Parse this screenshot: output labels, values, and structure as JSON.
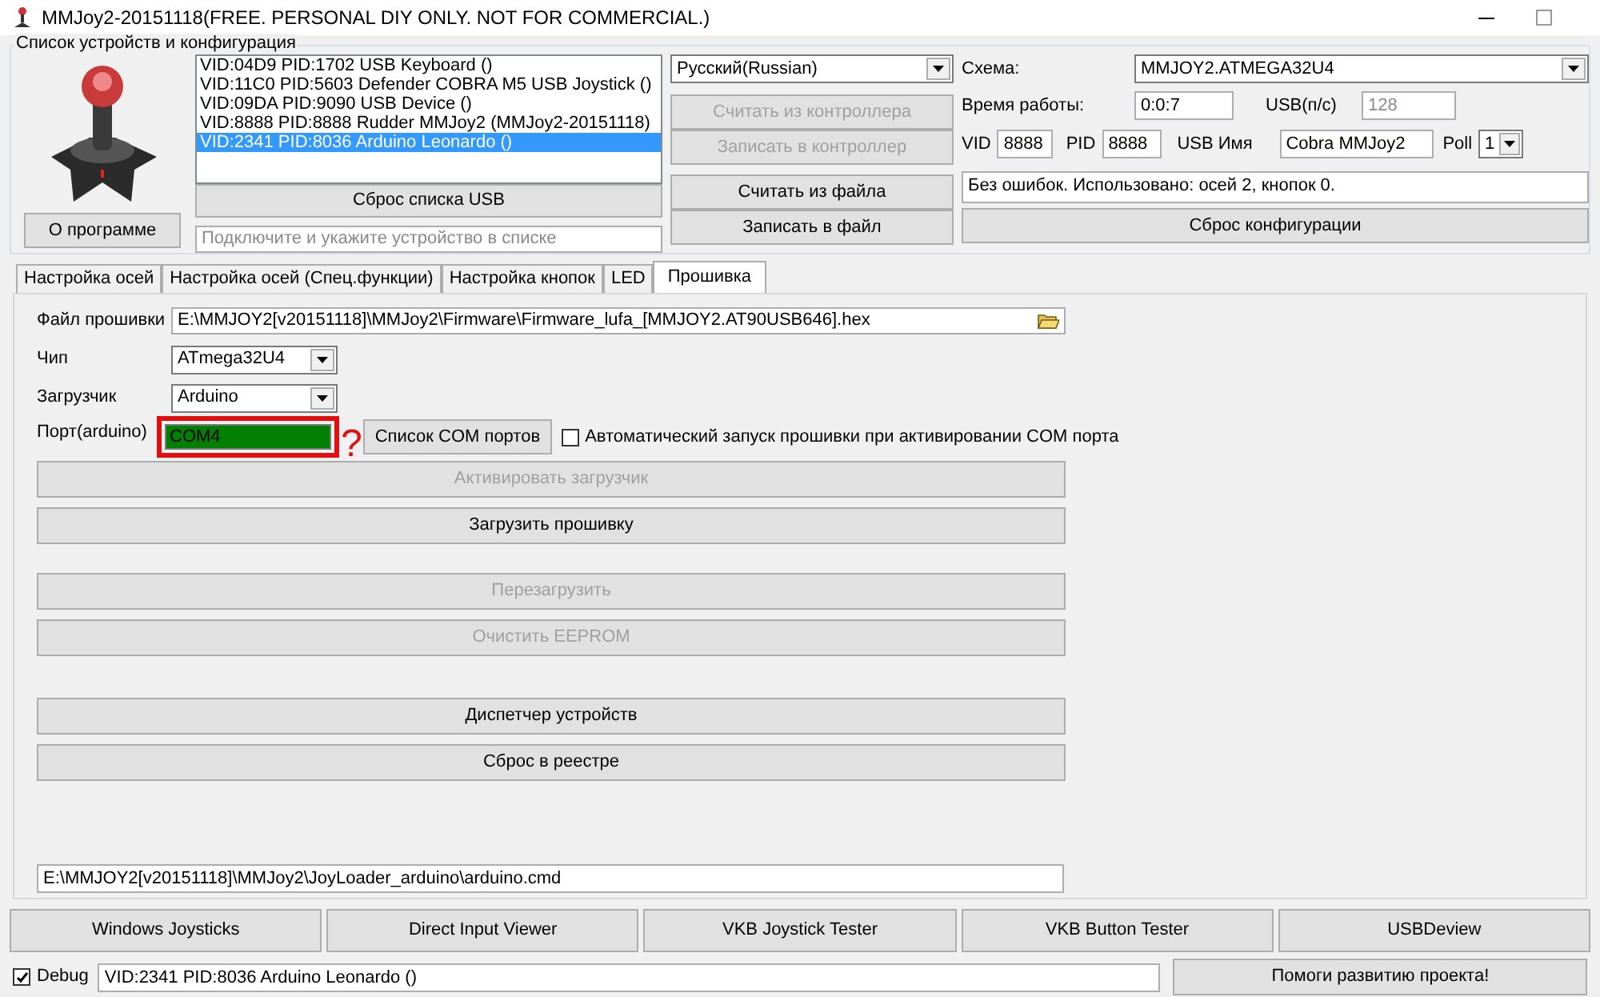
{
  "window": {
    "title": "MMJoy2-20151118(FREE. PERSONAL DIY ONLY. NOT FOR COMMERCIAL.)"
  },
  "device_group": {
    "legend": "Список устройств и конфигурация",
    "devices": [
      {
        "label": "VID:04D9 PID:1702 USB Keyboard ()",
        "selected": false
      },
      {
        "label": "VID:11C0 PID:5603 Defender COBRA M5 USB Joystick ()",
        "selected": false
      },
      {
        "label": "VID:09DA PID:9090 USB Device ()",
        "selected": false
      },
      {
        "label": "VID:8888 PID:8888 Rudder MMJoy2 (MMJoy2-20151118)",
        "selected": false
      },
      {
        "label": "VID:2341 PID:8036 Arduino Leonardo ()",
        "selected": true
      }
    ],
    "reset_usb_button": "Сброс списка USB",
    "about_button": "О программе",
    "status_field": {
      "placeholder": "Подключите и укажите устройство в списке"
    }
  },
  "language": {
    "value": "Русский(Russian)"
  },
  "controller_buttons": [
    {
      "label": "Считать из контроллера",
      "disabled": true
    },
    {
      "label": "Записать в контроллер",
      "disabled": true
    },
    {
      "label": "Считать из файла",
      "disabled": false
    },
    {
      "label": "Записать в файл",
      "disabled": false
    }
  ],
  "config": {
    "scheme_label": "Схема:",
    "scheme": "MMJOY2.ATMEGA32U4",
    "uptime_label": "Время работы:",
    "uptime": "0:0:7",
    "usb_rate_label": "USB(п/с)",
    "usb_rate": "128",
    "usb_rate_disabled": true,
    "vid_label": "VID",
    "vid": "8888",
    "pid_label": "PID",
    "pid": "8888",
    "usb_name_label": "USB Имя",
    "usb_name": "Cobra MMJoy2",
    "poll_label": "Poll",
    "poll": "1",
    "status": "Без ошибок. Использовано: осей  2, кнопок  0.",
    "reset_button": "Сброс конфигурации"
  },
  "tabs": [
    {
      "label": "Настройка осей",
      "selected": false
    },
    {
      "label": "Настройка осей (Спец.функции)",
      "selected": false
    },
    {
      "label": "Настройка кнопок",
      "selected": false
    },
    {
      "label": "LED",
      "selected": false
    },
    {
      "label": "Прошивка",
      "selected": true
    }
  ],
  "firmware": {
    "file_label": "Файл прошивки",
    "file": "E:\\MMJOY2[v20151118]\\MMJoy2\\Firmware\\Firmware_lufa_[MMJOY2.AT90USB646].hex",
    "chip_label": "Чип",
    "chip": "ATmega32U4",
    "loader_label": "Загрузчик",
    "loader": "Arduino",
    "port_label": "Порт(arduino)",
    "port": "COM4",
    "com_list_button": "Список COM портов",
    "annotation_mark": "?",
    "auto_start": {
      "label": "Автоматический запуск прошивки при активировании COM порта",
      "checked": false
    },
    "button_groups": [
      [
        {
          "label": "Активировать загрузчик",
          "disabled": true
        },
        {
          "label": "Загрузить прошивку",
          "disabled": false
        }
      ],
      [
        {
          "label": "Перезагрузить",
          "disabled": true
        },
        {
          "label": "Очистить EEPROM",
          "disabled": true
        }
      ],
      [
        {
          "label": "Диспетчер устройств",
          "disabled": false
        },
        {
          "label": "Сброс в реестре",
          "disabled": false
        }
      ]
    ],
    "cmd_path": "E:\\MMJOY2[v20151118]\\MMJoy2\\JoyLoader_arduino\\arduino.cmd"
  },
  "tools": [
    "Windows Joysticks",
    "Direct Input Viewer",
    "VKB Joystick Tester",
    "VKB Button Tester",
    "USBDeview"
  ],
  "debug": {
    "label": "Debug",
    "checked": true,
    "value": "VID:2341 PID:8036 Arduino Leonardo ()"
  },
  "support_button": "Помоги развитию проекта!"
}
